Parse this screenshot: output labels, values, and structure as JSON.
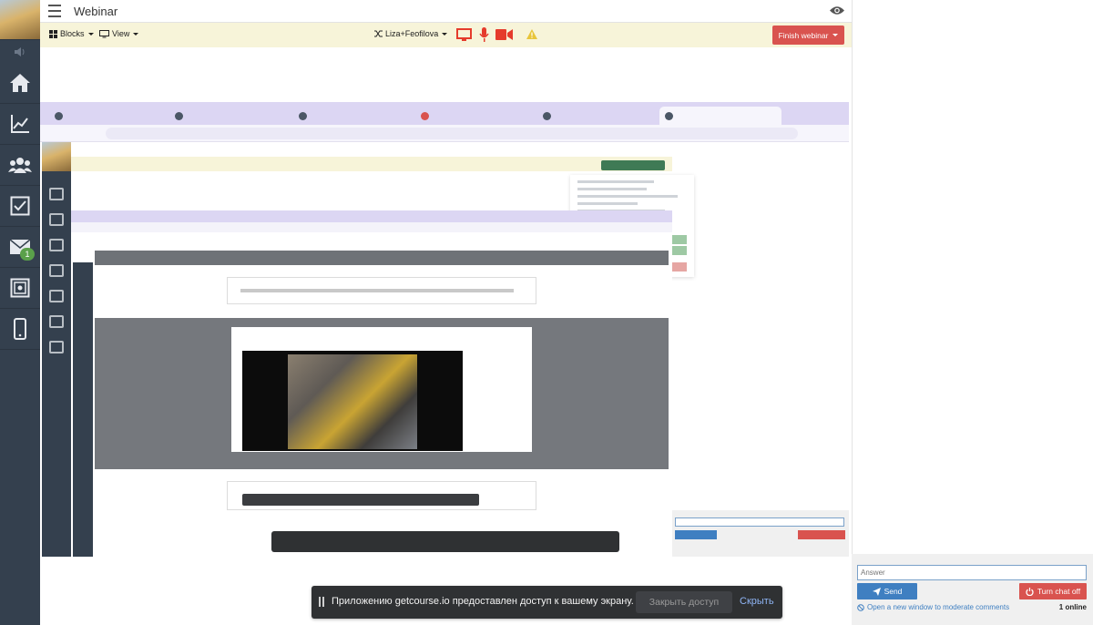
{
  "app": {
    "title": "Webinar"
  },
  "sidebar": {
    "items": [
      {
        "name": "home",
        "icon": "home-icon"
      },
      {
        "name": "stats",
        "icon": "chart-icon"
      },
      {
        "name": "users",
        "icon": "users-icon"
      },
      {
        "name": "tasks",
        "icon": "checkbox-icon"
      },
      {
        "name": "messages",
        "icon": "envelope-icon",
        "badge": "1"
      },
      {
        "name": "safe",
        "icon": "safe-icon"
      },
      {
        "name": "mobile",
        "icon": "phone-icon"
      }
    ]
  },
  "toolbar": {
    "blocks_label": "Blocks",
    "view_label": "View",
    "user_label": "Liza+Feofilova",
    "finish_label": "Finish webinar"
  },
  "chat": {
    "answer_placeholder": "Answer",
    "send_label": "Send",
    "turn_off_label": "Turn chat off",
    "moderate_link": "Open a new window to moderate comments",
    "online_count": "1 online"
  },
  "share_bar": {
    "message": "Приложению getcourse.io предоставлен доступ к вашему экрану.",
    "close_label": "Закрыть доступ",
    "hide_label": "Скрыть"
  },
  "colors": {
    "sidebar_bg": "#34404e",
    "toolbar_bg": "#f7f4d9",
    "finish": "#d9534f",
    "send": "#3f7fc1",
    "icon_red": "#e53b2c",
    "warning": "#e8c53a"
  }
}
